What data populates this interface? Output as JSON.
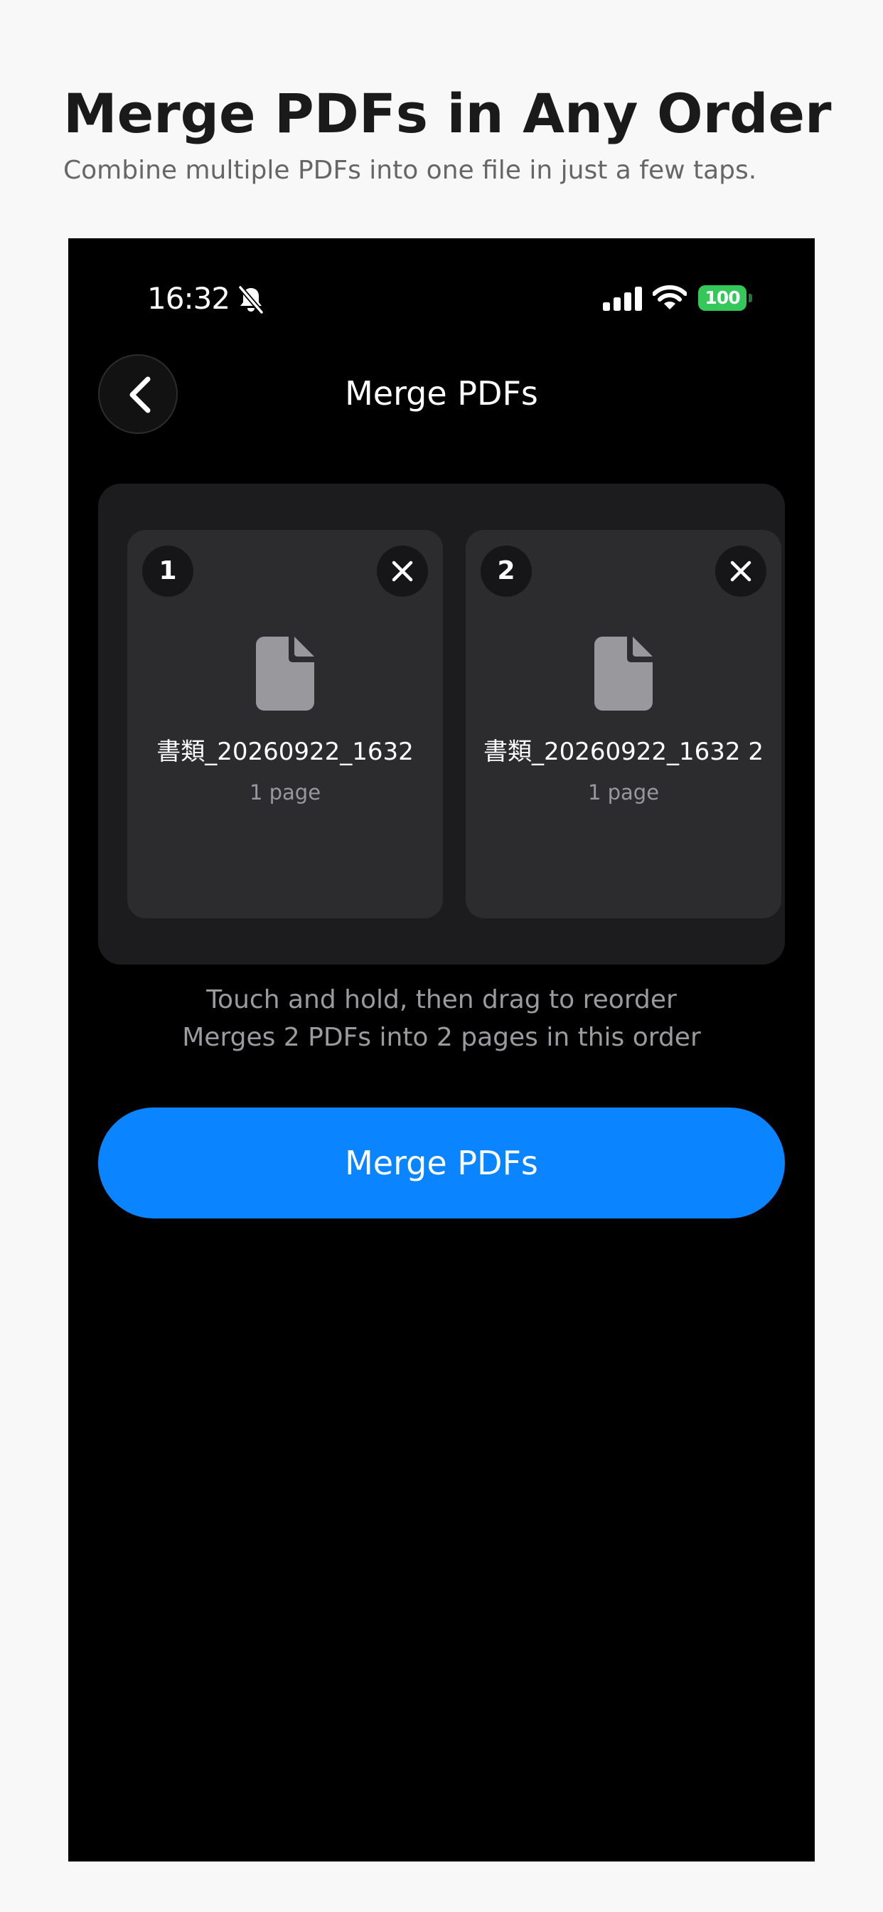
{
  "promo": {
    "title": "Merge PDFs in Any Order",
    "subtitle": "Combine multiple PDFs into one file in just a few taps."
  },
  "status_bar": {
    "time": "16:32",
    "battery": "100",
    "icons": [
      "bell-off-icon",
      "signal-icon",
      "wifi-icon",
      "battery-icon"
    ]
  },
  "nav": {
    "back_icon": "chevron-left-icon",
    "title": "Merge PDFs"
  },
  "files": [
    {
      "order": "1",
      "name": "書類_20260922_1632",
      "pages": "1 page",
      "icon": "document-icon",
      "remove_icon": "close-icon"
    },
    {
      "order": "2",
      "name": "書類_20260922_1632 2",
      "pages": "1 page",
      "icon": "document-icon",
      "remove_icon": "close-icon"
    }
  ],
  "hints": {
    "reorder": "Touch and hold, then drag to reorder",
    "summary": "Merges 2 PDFs into 2 pages in this order"
  },
  "merge_button": {
    "label": "Merge PDFs"
  },
  "colors": {
    "accent": "#0a84ff",
    "battery": "#34c759",
    "background": "#000000",
    "panel": "#1c1c1e",
    "card": "#2c2c2e"
  }
}
